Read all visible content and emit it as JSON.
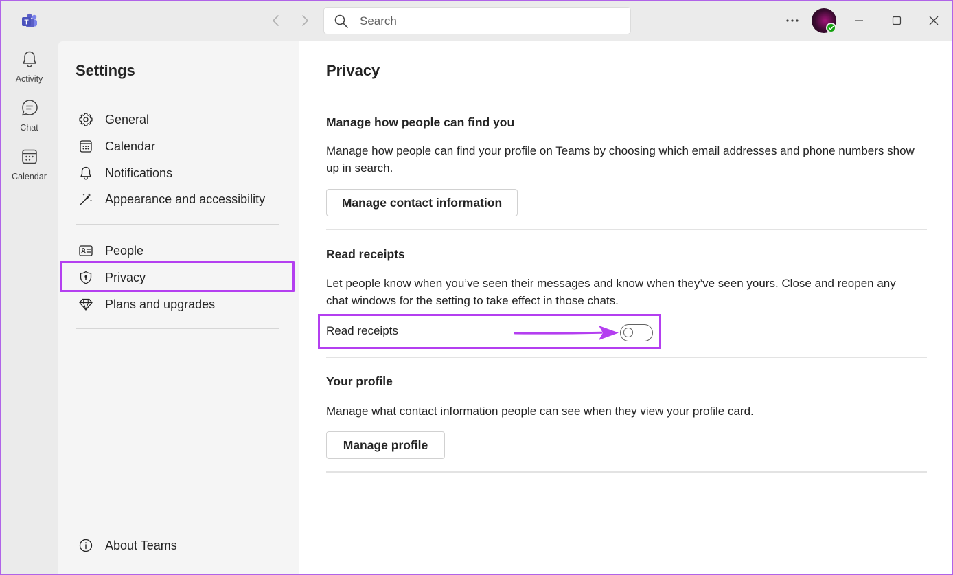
{
  "app": {
    "logo_icon": "teams-logo-icon",
    "brand_color": "#5b5fc7",
    "highlight_color": "#b43ff0"
  },
  "titlebar": {
    "back_icon": "chevron-left-icon",
    "forward_icon": "chevron-right-icon",
    "search_placeholder": "Search",
    "more_icon": "ellipsis-icon",
    "minimize_icon": "minimize-icon",
    "maximize_icon": "maximize-icon",
    "close_icon": "close-icon"
  },
  "rail": {
    "items": [
      {
        "label": "Activity",
        "icon": "bell-icon"
      },
      {
        "label": "Chat",
        "icon": "chat-icon"
      },
      {
        "label": "Calendar",
        "icon": "calendar-icon"
      }
    ]
  },
  "settings": {
    "title": "Settings",
    "items": [
      {
        "label": "General",
        "icon": "gear-icon"
      },
      {
        "label": "Calendar",
        "icon": "calendar-icon"
      },
      {
        "label": "Notifications",
        "icon": "bell-icon"
      },
      {
        "label": "Appearance and accessibility",
        "icon": "magic-wand-icon"
      },
      {
        "label": "People",
        "icon": "contact-card-icon"
      },
      {
        "label": "Privacy",
        "icon": "shield-icon",
        "selected": true
      },
      {
        "label": "Plans and upgrades",
        "icon": "diamond-icon"
      }
    ],
    "footer": {
      "label": "About Teams",
      "icon": "info-icon"
    }
  },
  "content": {
    "title": "Privacy",
    "sections": [
      {
        "heading": "Manage how people can find you",
        "text": "Manage how people can find your profile on Teams by choosing which email addresses and phone numbers show up in search.",
        "button": "Manage contact information"
      },
      {
        "heading": "Read receipts",
        "text": "Let people know when you’ve seen their messages and know when they’ve seen yours. Close and reopen any chat windows for the setting to take effect in those chats.",
        "toggle_label": "Read receipts",
        "toggle_on": false
      },
      {
        "heading": "Your profile",
        "text": "Manage what contact information people can see when they view your profile card.",
        "button": "Manage profile"
      }
    ]
  }
}
